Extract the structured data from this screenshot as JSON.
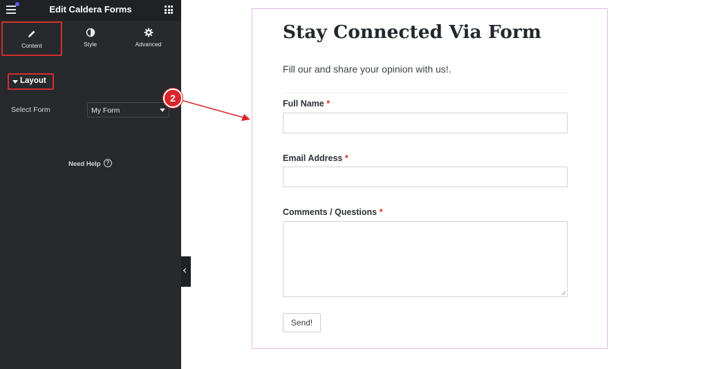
{
  "sidebar": {
    "title": "Edit Caldera Forms",
    "tabs": [
      {
        "label": "Content",
        "icon": "pencil-icon",
        "active": true
      },
      {
        "label": "Style",
        "icon": "half-circle-icon",
        "active": false
      },
      {
        "label": "Advanced",
        "icon": "gear-icon",
        "active": false
      }
    ],
    "section_title": "Layout",
    "select_form_label": "Select Form",
    "select_form_value": "My Form",
    "need_help": "Need Help",
    "help_icon_glyph": "?"
  },
  "annotation": {
    "step_number": "2",
    "color": "#d9252b"
  },
  "form": {
    "title": "Stay Connected Via Form",
    "subtitle": "Fill our and share your opinion with us!.",
    "fields": [
      {
        "label": "Full Name",
        "required_mark": "*",
        "value": ""
      },
      {
        "label": "Email Address",
        "required_mark": "*",
        "value": ""
      },
      {
        "label": "Comments / Questions",
        "required_mark": "*",
        "value": ""
      }
    ],
    "submit_label": "Send!"
  },
  "colors": {
    "sidebar_bg": "#27292d",
    "header_bg": "#1f2124",
    "highlight_red": "#d32f2f",
    "widget_border": "#e3b7e6"
  }
}
